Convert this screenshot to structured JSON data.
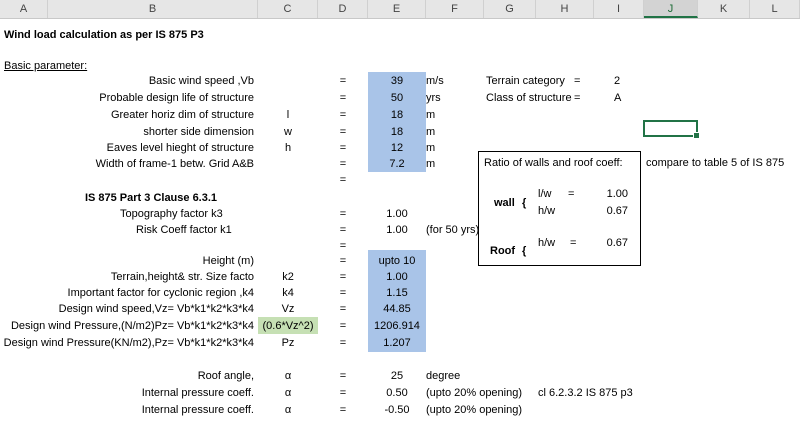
{
  "columns": [
    "A",
    "B",
    "C",
    "D",
    "E",
    "F",
    "G",
    "H",
    "I",
    "J",
    "K",
    "L"
  ],
  "selected_column": "J",
  "title": "Wind load  calculation as per IS 875 P3",
  "section_basic": "Basic parameter:",
  "rows": {
    "vb": {
      "label": "Basic wind speed ,Vb",
      "sym": "",
      "eq": "=",
      "val": "39",
      "unit": "m/s"
    },
    "life": {
      "label": "Probable design life of structure",
      "sym": "",
      "eq": "=",
      "val": "50",
      "unit": "yrs"
    },
    "greater": {
      "label": "Greater horiz dim of structure",
      "sym": "l",
      "eq": "=",
      "val": "18",
      "unit": "m"
    },
    "shorter": {
      "label": "shorter side dimension",
      "sym": "w",
      "eq": "=",
      "val": "18",
      "unit": "m"
    },
    "eaves": {
      "label": "Eaves level hieght of structure",
      "sym": "h",
      "eq": "=",
      "val": "12",
      "unit": "m"
    },
    "width": {
      "label": "Width of frame-1 betw. Grid A&B",
      "sym": "",
      "eq": "=",
      "val": "7.2",
      "unit": "m"
    },
    "blank_eq": {
      "eq": "="
    },
    "clause": {
      "label": "IS 875 Part 3 Clause 6.3.1"
    },
    "k3": {
      "label": "Topography factor  k3",
      "sym": "",
      "eq": "=",
      "val": "1.00",
      "unit": ""
    },
    "k1": {
      "label": "Risk Coeff factor    k1",
      "sym": "",
      "eq": "=",
      "val": "1.00",
      "unit": "(for 50 yrs)"
    },
    "blank_eq2": {
      "eq": "="
    },
    "height": {
      "label": "Height (m)",
      "sym": "",
      "eq": "=",
      "val": "upto 10",
      "unit": ""
    },
    "k2": {
      "label": "Terrain,height& str. Size facto",
      "sym": "k2",
      "eq": "=",
      "val": "1.00",
      "unit": ""
    },
    "k4": {
      "label": "Important factor for cyclonic region ,k4",
      "sym": "k4",
      "eq": "=",
      "val": "1.15",
      "unit": ""
    },
    "vz": {
      "label": "Design wind speed,Vz= Vb*k1*k2*k3*k4",
      "sym": "Vz",
      "eq": "=",
      "val": "44.85",
      "unit": ""
    },
    "pz1": {
      "label": "Design wind Pressure,(N/m2)Pz= Vb*k1*k2*k3*k4",
      "sym": "(0.6*Vz^2)",
      "eq": "=",
      "val": "1206.914",
      "unit": ""
    },
    "pz2": {
      "label": "Design wind Pressure(KN/m2),Pz= Vb*k1*k2*k3*k4",
      "sym": "Pz",
      "eq": "=",
      "val": "1.207",
      "unit": ""
    },
    "roof": {
      "label": "Roof angle,",
      "sym": "α",
      "eq": "=",
      "val": "25",
      "unit": "degree"
    },
    "ip1": {
      "label": "Internal pressure coeff.",
      "sym": "α",
      "eq": "=",
      "val": "0.50",
      "unit": "(upto 20% opening)",
      "extra": "cl 6.2.3.2 IS 875 p3"
    },
    "ip2": {
      "label": "Internal pressure coeff.",
      "sym": "α",
      "eq": "=",
      "val": "-0.50",
      "unit": "(upto 20% opening)"
    }
  },
  "terrain": {
    "label": "Terrain category",
    "eq": "=",
    "val": "2"
  },
  "class": {
    "label": "Class of structure",
    "eq": "=",
    "val": "A"
  },
  "ratio": {
    "title": "Ratio of walls and roof coeff:",
    "compare": "compare to table 5 of IS 875",
    "wall_label": "wall",
    "roof_label": "Roof",
    "brace": "{",
    "lw_label": "l/w",
    "lw_eq": "=",
    "lw_val": "1.00",
    "hw_label": "h/w",
    "hw_val": "0.67",
    "roof_hw_label": "h/w",
    "roof_hw_eq": "=",
    "roof_hw_val": "0.67"
  }
}
